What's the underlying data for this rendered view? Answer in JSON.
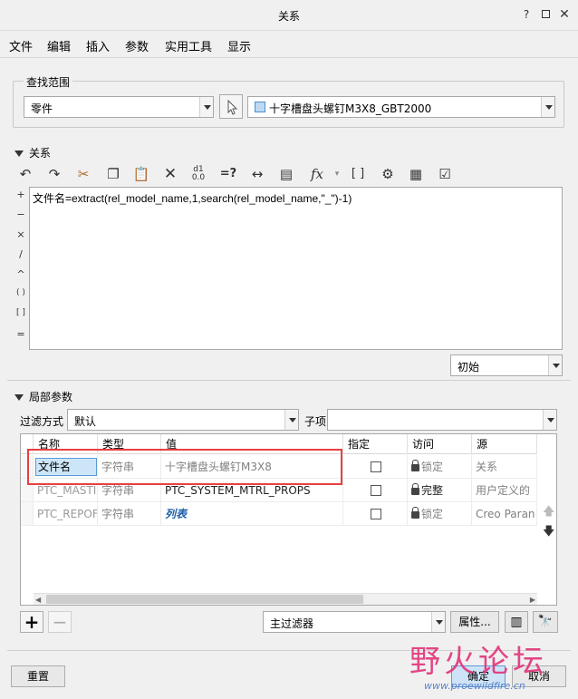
{
  "window": {
    "title": "关系",
    "help": "?"
  },
  "menu": [
    "文件",
    "编辑",
    "插入",
    "参数",
    "实用工具",
    "显示"
  ],
  "scope": {
    "legend": "查找范围",
    "type_value": "零件",
    "model_value": "十字槽盘头螺钉M3X8_GBT2000"
  },
  "relations": {
    "header": "关系",
    "operators": [
      "+",
      "−",
      "×",
      "/",
      "^",
      "( )",
      "[ ]",
      "="
    ],
    "text": "文件名=extract(rel_model_name,1,search(rel_model_name,\"_\")-1)",
    "unit_value": "初始",
    "toolbar_icons": [
      "undo-icon",
      "redo-icon",
      "cut-icon",
      "copy-icon",
      "paste-icon",
      "delete-icon",
      "evaluate-icon",
      "equals-icon",
      "measure-icon",
      "sort-icon",
      "function-icon",
      "brackets-icon",
      "verify-icon",
      "parameters-icon",
      "check-icon"
    ]
  },
  "local_params": {
    "header": "局部参数",
    "filter_label": "过滤方式",
    "filter_value": "默认",
    "subitem_label": "子项",
    "columns": [
      "名称",
      "类型",
      "值",
      "指定",
      "访问",
      "源"
    ],
    "rows": [
      {
        "name": "文件名",
        "type": "字符串",
        "value": "十字槽盘头螺钉M3X8",
        "access": "锁定",
        "source": "关系"
      },
      {
        "name": "PTC_MASTI",
        "type": "字符串",
        "value": "PTC_SYSTEM_MTRL_PROPS",
        "access": "完整",
        "source": "用户定义的"
      },
      {
        "name": "PTC_REPOF",
        "type": "字符串",
        "value": "列表",
        "access": "锁定",
        "source": "Creo Paran"
      }
    ],
    "main_filter": "主过滤器",
    "properties_btn": "属性..."
  },
  "footer": {
    "reset": "重置",
    "ok": "确定",
    "cancel": "取消"
  },
  "watermark": {
    "text": "野火论坛",
    "url": "www.proewildfire.cn"
  },
  "colors": {
    "highlight": "#e8403f",
    "selected_cell": "#cde6f7",
    "link_blue": "#1f5fa8"
  }
}
